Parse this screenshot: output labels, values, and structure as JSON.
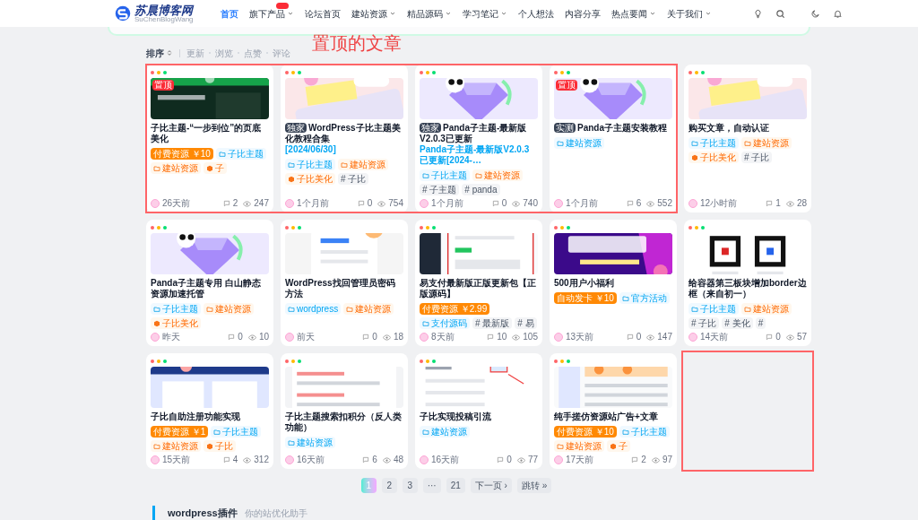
{
  "header": {
    "logo": {
      "title": "苏晨博客网",
      "subtitle": "SuChenBlogWang"
    },
    "nav": [
      {
        "label": "首页",
        "selected": true,
        "has_menu": false,
        "badge": false
      },
      {
        "label": "旗下产品",
        "selected": false,
        "has_menu": true,
        "badge": true
      },
      {
        "label": "论坛首页",
        "selected": false,
        "has_menu": false,
        "badge": false
      },
      {
        "label": "建站资源",
        "selected": false,
        "has_menu": true,
        "badge": false
      },
      {
        "label": "精品源码",
        "selected": false,
        "has_menu": true,
        "badge": false
      },
      {
        "label": "学习笔记",
        "selected": false,
        "has_menu": true,
        "badge": false
      },
      {
        "label": "个人想法",
        "selected": false,
        "has_menu": false,
        "badge": false
      },
      {
        "label": "内容分享",
        "selected": false,
        "has_menu": false,
        "badge": false
      },
      {
        "label": "热点要闻",
        "selected": false,
        "has_menu": true,
        "badge": false
      },
      {
        "label": "关于我们",
        "selected": false,
        "has_menu": true,
        "badge": false
      }
    ]
  },
  "annotation": {
    "text": "置顶的文章"
  },
  "sort": {
    "label": "排序",
    "options": [
      "更新",
      "浏览",
      "点赞",
      "评论"
    ]
  },
  "cards": [
    {
      "thumbnail": {
        "kind": "picture"
      },
      "image_badge": "置顶",
      "framed": true,
      "title": "子比主题-“一步到位”的页底美化",
      "tags": [
        {
          "kind": "price",
          "text": "付费资源 ￥10"
        },
        {
          "kind": "folder-blue",
          "text": "子比主题"
        },
        {
          "kind": "folder-orange",
          "text": "建站资源"
        },
        {
          "kind": "cube",
          "text": "子"
        }
      ],
      "time": "26天前",
      "comments": "2",
      "views": "247"
    },
    {
      "thumbnail": {
        "kind": "picture"
      },
      "framed": true,
      "label": "独家",
      "title": "WordPress子比主题美化教程合集",
      "subtitle": "[2024/06/30]",
      "tags": [
        {
          "kind": "folder-blue",
          "text": "子比主题"
        },
        {
          "kind": "folder-orange",
          "text": "建站资源"
        },
        {
          "kind": "cube",
          "text": "子比美化"
        },
        {
          "kind": "hash",
          "text": "# 子比"
        }
      ],
      "time": "1个月前",
      "comments": "0",
      "views": "754"
    },
    {
      "thumbnail": {
        "kind": "picture"
      },
      "framed": true,
      "label": "独家",
      "title": "Panda子主题-最新版V2.0.3已更新",
      "subtitle": "Panda子主题-最新版V2.0.3已更新[2024-…",
      "tags": [
        {
          "kind": "folder-blue",
          "text": "子比主题"
        },
        {
          "kind": "folder-orange",
          "text": "建站资源"
        },
        {
          "kind": "hash",
          "text": "# 子主题"
        },
        {
          "kind": "hash",
          "text": "# panda"
        }
      ],
      "time": "1个月前",
      "comments": "0",
      "views": "740"
    },
    {
      "thumbnail": {
        "kind": "picture"
      },
      "image_badge": "置顶",
      "framed": true,
      "label": "实测",
      "title": "Panda子主题安装教程",
      "tags": [
        {
          "kind": "folder-blue",
          "text": "建站资源"
        }
      ],
      "time": "1个月前",
      "comments": "6",
      "views": "552"
    },
    {
      "thumbnail": {
        "kind": "picture"
      },
      "framed": false,
      "title": "购买文章，自动认证",
      "tags": [
        {
          "kind": "folder-blue",
          "text": "子比主题"
        },
        {
          "kind": "folder-orange",
          "text": "建站资源"
        },
        {
          "kind": "cube",
          "text": "子比美化"
        },
        {
          "kind": "hash",
          "text": "# 子比"
        }
      ],
      "time": "12小时前",
      "comments": "1",
      "views": "28"
    },
    {
      "thumbnail": {
        "kind": "picture"
      },
      "framed": false,
      "title": "Panda子主题专用 白山静态资源加速托管",
      "tags": [
        {
          "kind": "folder-blue",
          "text": "子比主题"
        },
        {
          "kind": "folder-orange",
          "text": "建站资源"
        },
        {
          "kind": "cube",
          "text": "子比美化"
        }
      ],
      "time": "昨天",
      "comments": "0",
      "views": "10"
    },
    {
      "thumbnail": {
        "kind": "picture"
      },
      "framed": false,
      "title": "WordPress找回管理员密码方法",
      "tags": [
        {
          "kind": "folder-blue",
          "text": "wordpress"
        },
        {
          "kind": "folder-orange",
          "text": "建站资源"
        }
      ],
      "time": "前天",
      "comments": "0",
      "views": "18"
    },
    {
      "thumbnail": {
        "kind": "picture"
      },
      "framed": false,
      "title": "易支付最新版正版更新包【正版源码】",
      "tags": [
        {
          "kind": "price",
          "text": "付费资源 ￥2.99"
        },
        {
          "kind": "folder-blue",
          "text": "支付源码"
        },
        {
          "kind": "hash",
          "text": "# 最新版"
        },
        {
          "kind": "hash",
          "text": "# 易"
        }
      ],
      "time": "8天前",
      "comments": "10",
      "views": "105"
    },
    {
      "thumbnail": {
        "kind": "picture"
      },
      "framed": false,
      "title": "500用户小福利",
      "tags": [
        {
          "kind": "price",
          "text": "自动发卡 ￥10"
        },
        {
          "kind": "folder-blue",
          "text": "官方活动"
        }
      ],
      "time": "13天前",
      "comments": "0",
      "views": "147"
    },
    {
      "thumbnail": {
        "kind": "picture"
      },
      "framed": false,
      "title": "给容器第三板块增加border边框（来自初一）",
      "tags": [
        {
          "kind": "folder-blue",
          "text": "子比主题"
        },
        {
          "kind": "folder-orange",
          "text": "建站资源"
        },
        {
          "kind": "hash",
          "text": "# 子比"
        },
        {
          "kind": "hash",
          "text": "# 美化"
        },
        {
          "kind": "hash",
          "text": "#"
        }
      ],
      "time": "14天前",
      "comments": "0",
      "views": "57"
    },
    {
      "thumbnail": {
        "kind": "picture"
      },
      "framed": false,
      "title": "子比自助注册功能实现",
      "tags": [
        {
          "kind": "price",
          "text": "付费资源 ￥1"
        },
        {
          "kind": "folder-blue",
          "text": "子比主题"
        },
        {
          "kind": "folder-orange",
          "text": "建站资源"
        },
        {
          "kind": "cube",
          "text": "子比"
        }
      ],
      "time": "15天前",
      "comments": "4",
      "views": "312"
    },
    {
      "thumbnail": {
        "kind": "picture"
      },
      "framed": false,
      "title": "子比主题搜索扣积分（反人类功能）",
      "tags": [
        {
          "kind": "folder-blue",
          "text": "建站资源"
        }
      ],
      "time": "16天前",
      "comments": "6",
      "views": "48"
    },
    {
      "thumbnail": {
        "kind": "picture"
      },
      "framed": false,
      "title": "子比实现投稿引流",
      "tags": [
        {
          "kind": "folder-blue",
          "text": "建站资源"
        }
      ],
      "time": "16天前",
      "comments": "0",
      "views": "77"
    },
    {
      "thumbnail": {
        "kind": "picture"
      },
      "framed": false,
      "title": "纯手搓仿资源站广告+文章",
      "tags": [
        {
          "kind": "price",
          "text": "付费资源 ￥10"
        },
        {
          "kind": "folder-blue",
          "text": "子比主题"
        },
        {
          "kind": "folder-orange",
          "text": "建站资源"
        },
        {
          "kind": "cube",
          "text": "子"
        }
      ],
      "time": "17天前",
      "comments": "2",
      "views": "97"
    }
  ],
  "empty_slot": {
    "framed": true
  },
  "pagination": [
    {
      "label": "1",
      "selected": true
    },
    {
      "label": "2",
      "selected": false
    },
    {
      "label": "3",
      "selected": false
    },
    {
      "label": "···",
      "selected": false
    },
    {
      "label": "21",
      "selected": false
    },
    {
      "label": "下一页 ›",
      "selected": false
    },
    {
      "label": "跳转 »",
      "selected": false
    }
  ],
  "section": {
    "title": "wordpress插件",
    "subtitle": "你的站优化助手"
  }
}
